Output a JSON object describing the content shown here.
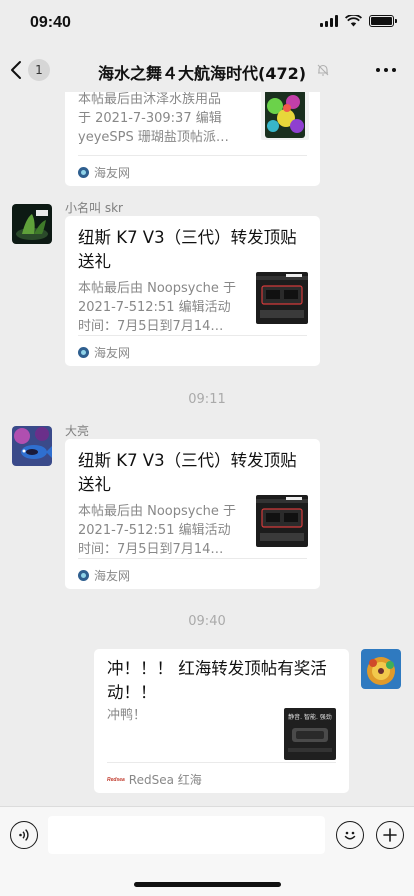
{
  "status_bar": {
    "time": "09:40"
  },
  "nav": {
    "unread_count": "1",
    "title": "海水之舞４大航海时代(472)"
  },
  "messages": [
    {
      "card": {
        "desc_lines": [
          "本帖最后由沐泽水族用品",
          "于 2021-7-309:37 编辑",
          "yeyeSPS 珊瑚盐顶帖派…"
        ],
        "source": "海友网"
      }
    },
    {
      "sender": "小名叫 skr",
      "card": {
        "title_lines": [
          "纽斯 K7 V3（三代）转发顶贴",
          "送礼"
        ],
        "desc_lines": [
          "本帖最后由 Noopsyche 于",
          "2021-7-512:51 编辑活动",
          "时间：7月5日到7月14…"
        ],
        "source": "海友网"
      }
    },
    {
      "timestamp": "09:11"
    },
    {
      "sender": "大亮",
      "card": {
        "title_lines": [
          "纽斯 K7 V3（三代）转发顶贴",
          "送礼"
        ],
        "desc_lines": [
          "本帖最后由 Noopsyche 于",
          "2021-7-512:51 编辑活动",
          "时间：7月5日到7月14…"
        ],
        "source": "海友网"
      }
    },
    {
      "timestamp": "09:40"
    },
    {
      "card": {
        "title_lines": [
          "冲！！！ 红海转发顶帖有奖活",
          "动！！"
        ],
        "desc_lines": [
          "冲鸭！"
        ],
        "thumb_text": "静音. 智能. 强劲",
        "source_brand": "Redsea",
        "source": "RedSea 红海"
      }
    }
  ],
  "input": {
    "value": ""
  }
}
